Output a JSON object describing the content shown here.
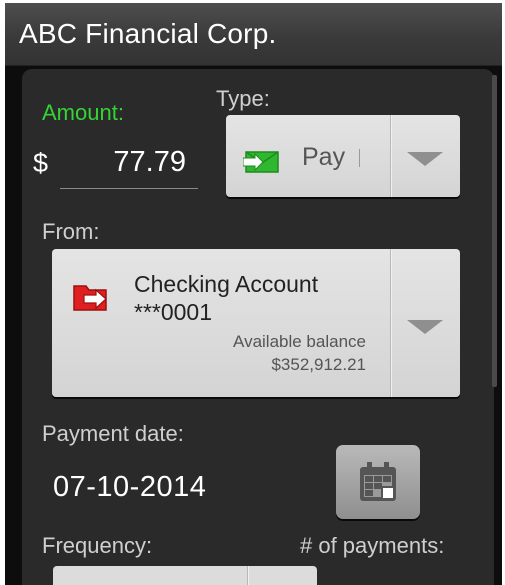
{
  "header": {
    "title": "ABC Financial Corp."
  },
  "amount": {
    "label": "Amount:",
    "currency_symbol": "$",
    "value": "77.79"
  },
  "type": {
    "label": "Type:",
    "selected": "Pay",
    "icon": "green-envelope-arrow-icon"
  },
  "from": {
    "label": "From:",
    "account_name": "Checking Account",
    "account_number": "***0001",
    "available_label": "Available balance",
    "available_value": "$352,912.21",
    "icon": "red-folder-arrow-icon"
  },
  "payment_date": {
    "label": "Payment date:",
    "value": "07-10-2014",
    "icon": "calendar-icon"
  },
  "frequency": {
    "label": "Frequency:"
  },
  "num_payments": {
    "label": "# of payments:"
  },
  "colors": {
    "accent_green": "#33d433",
    "icon_red": "#e02020",
    "icon_green": "#2fb82f"
  }
}
